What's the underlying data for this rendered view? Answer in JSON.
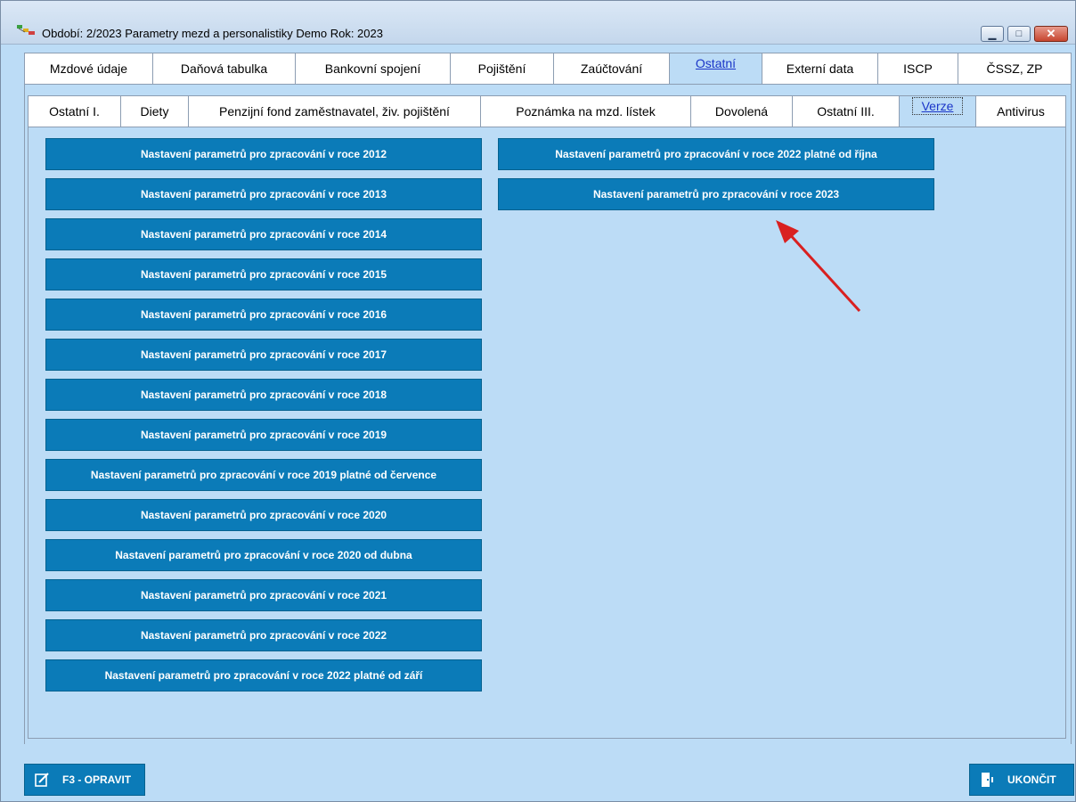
{
  "window": {
    "title": "Období: 2/2023 Parametry mezd a personalistiky  Demo  Rok: 2023",
    "controls": [
      "minimize-icon",
      "maximize-icon",
      "close-icon"
    ]
  },
  "main_tabs": [
    {
      "label": "Mzdové údaje"
    },
    {
      "label": "Daňová tabulka"
    },
    {
      "label": "Bankovní spojení"
    },
    {
      "label": "Pojištění"
    },
    {
      "label": "Zaúčtování"
    },
    {
      "label": "Ostatní",
      "active": true
    },
    {
      "label": "Externí data"
    },
    {
      "label": "ISCP"
    },
    {
      "label": "ČSSZ, ZP"
    }
  ],
  "sub_tabs": [
    {
      "label": "Ostatní I."
    },
    {
      "label": "Diety"
    },
    {
      "label": "Penzijní fond zaměstnavatel, živ. pojištění"
    },
    {
      "label": "Poznámka na mzd. lístek"
    },
    {
      "label": "Dovolená"
    },
    {
      "label": "Ostatní III."
    },
    {
      "label": "Verze",
      "active": true
    },
    {
      "label": "Antivirus"
    }
  ],
  "left_buttons": [
    {
      "label": "Nastavení parametrů pro zpracování v roce 2012"
    },
    {
      "label": "Nastavení parametrů pro zpracování v roce 2013"
    },
    {
      "label": "Nastavení parametrů pro zpracování v roce 2014"
    },
    {
      "label": "Nastavení parametrů pro zpracování v roce 2015"
    },
    {
      "label": "Nastavení parametrů pro zpracování v roce 2016"
    },
    {
      "label": "Nastavení parametrů pro zpracování v roce 2017"
    },
    {
      "label": "Nastavení parametrů pro zpracování v roce 2018"
    },
    {
      "label": "Nastavení parametrů pro zpracování v roce 2019"
    },
    {
      "label": "Nastavení parametrů pro zpracování v roce 2019 platné od července"
    },
    {
      "label": "Nastavení parametrů pro zpracování v roce 2020"
    },
    {
      "label": "Nastavení parametrů pro zpracování v roce 2020 od dubna"
    },
    {
      "label": "Nastavení parametrů pro zpracování v roce 2021"
    },
    {
      "label": "Nastavení parametrů pro zpracování v roce 2022"
    },
    {
      "label": "Nastavení parametrů pro zpracování v roce 2022 platné od září"
    }
  ],
  "right_buttons": [
    {
      "label": "Nastavení parametrů pro zpracování v roce 2022 platné od října"
    },
    {
      "label": "Nastavení parametrů pro zpracování v roce 2023"
    }
  ],
  "footer": {
    "edit_label": "F3 - OPRAVIT",
    "exit_label": "UKONČIT"
  },
  "colors": {
    "button_bg": "#0b7bb8",
    "panel_bg": "#bcdcf6",
    "arrow": "#d92020"
  }
}
